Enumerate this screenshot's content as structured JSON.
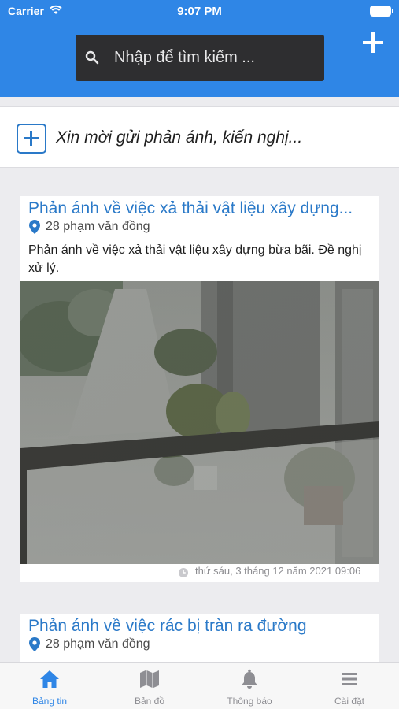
{
  "status_bar": {
    "carrier": "Carrier",
    "time": "9:07 PM"
  },
  "header": {
    "search_placeholder": "Nhập để tìm kiếm ...",
    "accent_color": "#2f86e6"
  },
  "compose": {
    "prompt": "Xin mời gửi phản ánh, kiến nghị..."
  },
  "feed": {
    "items": [
      {
        "title": "Phản ánh về việc xả thải vật liệu xây dựng...",
        "location": "28 phạm văn đồng",
        "body": "Phản ánh về việc xả thải vật liệu xây dựng bừa bãi. Đề nghị xử lý.",
        "timestamp": "thứ sáu, 3 tháng 12 năm 2021 09:06"
      },
      {
        "title": "Phản ánh về việc rác bị tràn ra đường",
        "location": "28 phạm văn đồng"
      }
    ]
  },
  "tabbar": {
    "tabs": [
      {
        "label": "Bảng tin",
        "icon": "home-icon",
        "active": true
      },
      {
        "label": "Bản đồ",
        "icon": "map-icon",
        "active": false
      },
      {
        "label": "Thông báo",
        "icon": "bell-icon",
        "active": false
      },
      {
        "label": "Cài đặt",
        "icon": "menu-icon",
        "active": false
      }
    ]
  }
}
